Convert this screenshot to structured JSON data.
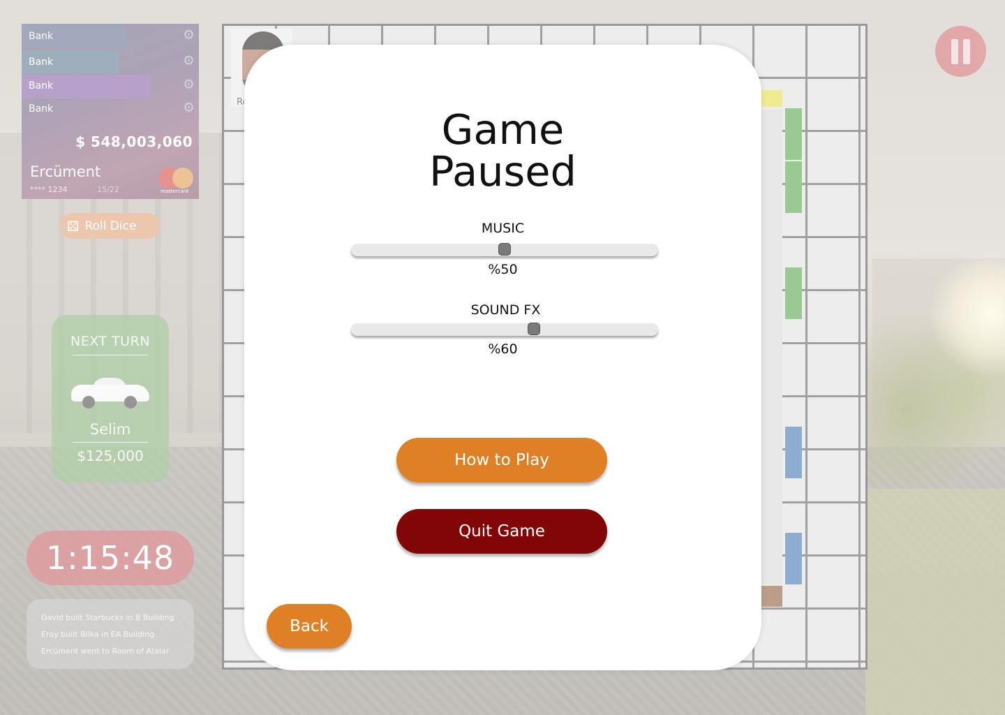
{
  "board": {
    "player_tile_label": "Roc"
  },
  "bank_card": {
    "rows": [
      {
        "label": "Bank",
        "icon": "gear-icon"
      },
      {
        "label": "Bank",
        "icon": "gear-icon"
      },
      {
        "label": "Bank",
        "icon": "gear-icon"
      },
      {
        "label": "Bank",
        "icon": "gear-icon"
      }
    ],
    "balance": "$ 548,003,060",
    "holder": "Ercüment",
    "card_number": "**** 1234",
    "expiry": "15/22",
    "brand": "mastercard"
  },
  "roll_dice": {
    "label": "Roll Dice",
    "icon": "dice-icon"
  },
  "next_turn": {
    "title": "NEXT TURN",
    "player": "Selim",
    "money": "$125,000",
    "icon": "car-icon"
  },
  "timer": "1:15:48",
  "log": [
    "David built Starbucks in B Building",
    "Eray built Bilka in EA Building",
    "Ercüment went to Room of Atalar"
  ],
  "pause_button": {
    "icon": "pause-icon"
  },
  "pause_menu": {
    "title_line1": "Game",
    "title_line2": "Paused",
    "music": {
      "label": "MUSIC",
      "value": 50,
      "value_text": "%50"
    },
    "sound_fx": {
      "label": "SOUND FX",
      "value": 60,
      "value_text": "%60"
    },
    "how_to_play": "How to Play",
    "quit_game": "Quit Game",
    "back": "Back"
  },
  "colors": {
    "orange": "#e08026",
    "dark_red": "#820607",
    "green": "#5aaa4f",
    "blue": "#4a7ab3",
    "yellow": "#e7e04a",
    "brown": "#93613f"
  }
}
